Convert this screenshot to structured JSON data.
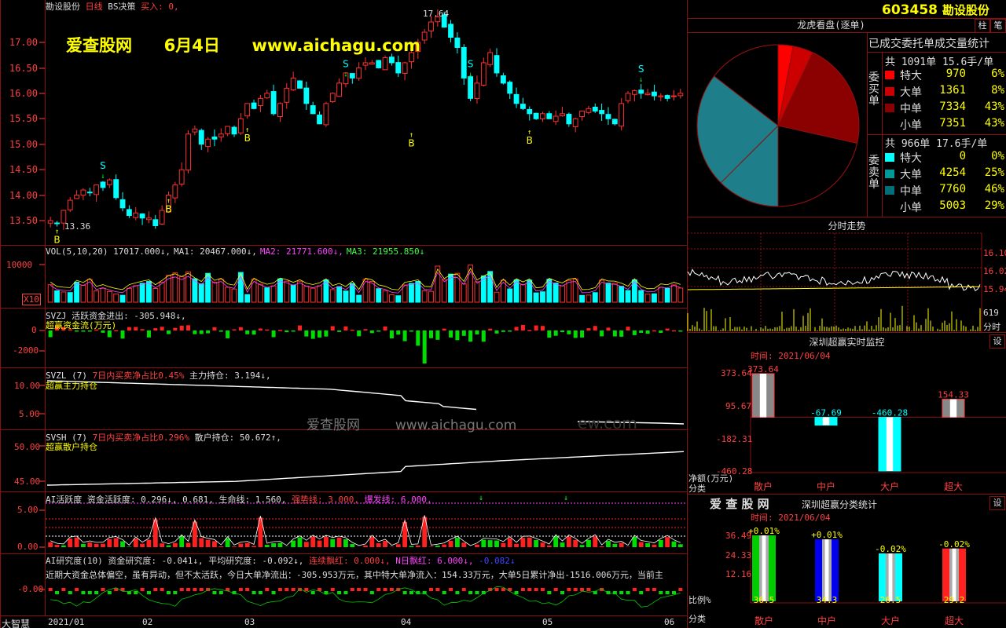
{
  "header": {
    "left_title": "勘设股份",
    "period": "日线",
    "strategy": "BS决策",
    "buy_in": "买入: 0,",
    "stock_code": "603458",
    "stock_name": "勘设股份",
    "buttons": [
      "柱",
      "笔"
    ]
  },
  "watermark": {
    "site_name": "爱查股网",
    "date": "6月4日",
    "url": "www.aichagu.com",
    "mid_site": "爱查股网",
    "mid_url": "www.aichagu.com",
    "faded_suffix": "ew.com"
  },
  "price_panel": {
    "y_ticks": [
      "17.00",
      "16.50",
      "16.00",
      "15.50",
      "15.00",
      "14.50",
      "14.00",
      "13.50"
    ],
    "high_label": "17.64",
    "low_label": "13.36",
    "b_label": "B",
    "s_label": "S"
  },
  "vol_panel": {
    "legend": [
      {
        "text": "VOL(5,10,20) 17017.000↓,",
        "color": "#dddddd"
      },
      {
        "text": "MA1: 20467.000↓,",
        "color": "#dddddd"
      },
      {
        "text": "MA2: 21771.600↓,",
        "color": "#ff44ff"
      },
      {
        "text": "MA3: 21955.850↓",
        "color": "#44ff44"
      }
    ],
    "y_tick": "10000",
    "unit": "X10"
  },
  "svzj_panel": {
    "legend": "SVZJ  活跃资金进出: -305.948↓,",
    "sublabel": "超赢资金流(万元)",
    "y_ticks": [
      "0",
      "-2000"
    ]
  },
  "svzl_panel": {
    "legend_a": "SVZL (7)",
    "legend_b": "7日内买卖净占比0.45%",
    "legend_c": "主力持仓: 3.194↓,",
    "sublabel": "超赢主力持仓",
    "y_ticks": [
      "10.00",
      "5.00"
    ]
  },
  "svsh_panel": {
    "legend_a": "SVSH (7)",
    "legend_b": "7日内买卖净占比0.296%",
    "legend_c": "散户持仓: 50.672↑,",
    "sublabel": "超赢散户持仓",
    "y_ticks": [
      "50.00",
      "45.00"
    ]
  },
  "ai_active_panel": {
    "legend_a": "AI活跃度 资金活跃度: 0.296↓, 0.681, 生命线: 1.560,",
    "legend_b": "强势线: 3.000,",
    "legend_c": "爆发线: 6.000,",
    "y_ticks": [
      "5.00",
      "0.00"
    ]
  },
  "ai_research_panel": {
    "legend_a": "AI研究度(10) 资金研究度: -0.041↓, 平均研究度: -0.092↓,",
    "legend_b": "连续飘红: 0.000↓,",
    "legend_c": "N日飘红: 6.000↓,",
    "legend_d": "-0.082↓",
    "comment": "近期大资金总体偏空，虽有异动，但不太活跃，今日大单净流出：-305.953万元，其中特大单净流入：154.33万元，大单5日累计净出-1516.006万元，当前主",
    "y_tick": "-0.00"
  },
  "bottom_axis": {
    "corner": "大智慧",
    "dates": [
      "2021/01",
      "02",
      "03",
      "04",
      "05",
      "06"
    ]
  },
  "order_pie": {
    "title": "龙虎看盘(逐单)",
    "subtitle": "已成交委托单成交量统计",
    "buy_group_label": "委买单",
    "sell_group_label": "委卖单",
    "buy_total": "共 1091单 15.6手/单",
    "sell_total": "共 966单 17.6手/单",
    "buy_rows": [
      {
        "name": "特大",
        "count": "970",
        "pct": "6%",
        "color": "#ff0000"
      },
      {
        "name": "大单",
        "count": "1361",
        "pct": "8%",
        "color": "#cc0000"
      },
      {
        "name": "中单",
        "count": "7334",
        "pct": "43%",
        "color": "#8b0000"
      },
      {
        "name": "小单",
        "count": "7351",
        "pct": "43%",
        "color": "#000000"
      }
    ],
    "sell_rows": [
      {
        "name": "特大",
        "count": "0",
        "pct": "0%",
        "color": "#00ffff"
      },
      {
        "name": "大单",
        "count": "4254",
        "pct": "25%",
        "color": "#009999"
      },
      {
        "name": "中单",
        "count": "7760",
        "pct": "46%",
        "color": "#006f7a"
      },
      {
        "name": "小单",
        "count": "5003",
        "pct": "29%",
        "color": "#000000"
      }
    ],
    "pie_slices": [
      {
        "value": 3,
        "color": "#ff0000"
      },
      {
        "value": 4,
        "color": "#cc0000"
      },
      {
        "value": 21.5,
        "color": "#8b0000"
      },
      {
        "value": 21.5,
        "color": "#000000"
      },
      {
        "value": 0,
        "color": "#00ffff"
      },
      {
        "value": 12.5,
        "color": "#1e7f8a"
      },
      {
        "value": 23,
        "color": "#1e7f8a"
      },
      {
        "value": 14.5,
        "color": "#000000"
      }
    ]
  },
  "intraday": {
    "title": "分时走势",
    "y_ticks": [
      "16.10",
      "16.02",
      "15.94"
    ],
    "vol_label": "619",
    "time_label": "分时"
  },
  "realtime_monitor": {
    "title": "深圳超赢实时监控",
    "settings": "设",
    "time": "时间: 2021/06/04",
    "y_ticks": [
      "373.64",
      "95.67",
      "-182.31",
      "-460.28"
    ],
    "unit_label": "净额(万元)",
    "category_label": "分类",
    "categories": [
      "散户",
      "中户",
      "大户",
      "超大"
    ],
    "values": [
      373.64,
      -67.69,
      -460.28,
      154.33
    ],
    "value_labels": [
      "373.64",
      "-67.69",
      "-460.28",
      "154.33"
    ]
  },
  "category_stats": {
    "brand": "爱 查 股 网",
    "title": "深圳超赢分类统计",
    "settings": "设",
    "time": "时间: 2021/06/04",
    "y_ticks": [
      "36.49",
      "24.33",
      "12.16"
    ],
    "ratio_label": "比例%",
    "category_label": "分类",
    "categories": [
      "散户",
      "中户",
      "大户",
      "超大"
    ],
    "values": [
      36.5,
      34.3,
      26.5,
      29.2
    ],
    "change_labels": [
      "+0.01%",
      "+0.01%",
      "-0.02%",
      "-0.02%"
    ],
    "colors": [
      "#00cc00",
      "#0000ee",
      "#00ffff",
      "#ff2020"
    ]
  }
}
